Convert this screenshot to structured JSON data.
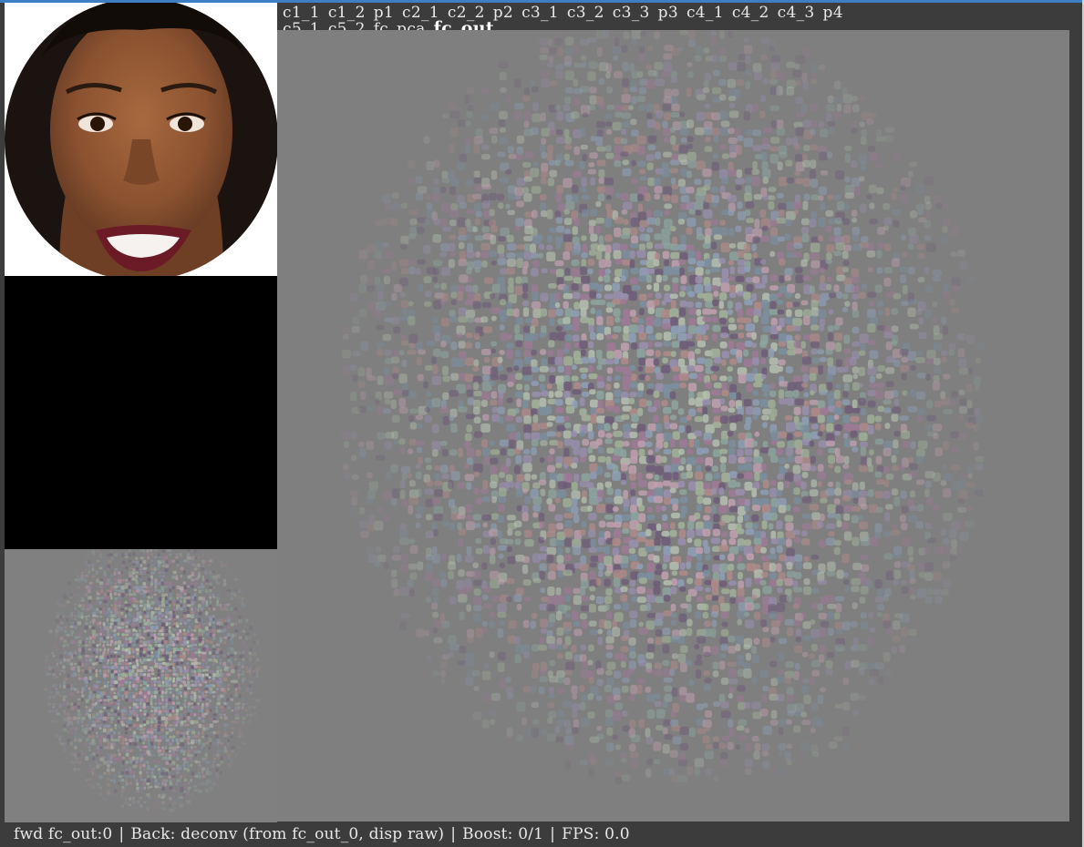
{
  "layers": {
    "row1": [
      "c1_1",
      "c1_2",
      "p1",
      "c2_1",
      "c2_2",
      "p2",
      "c3_1",
      "c3_2",
      "c3_3",
      "p3",
      "c4_1",
      "c4_2",
      "c4_3",
      "p4"
    ],
    "row2": [
      "c5_1",
      "c5_2",
      "fc",
      "pca",
      "fc_out"
    ],
    "selected": "fc_out"
  },
  "status": {
    "fwd": "fwd fc_out:0",
    "back": "Back: deconv (from fc_out_0, disp raw)",
    "boost": "Boost: 0/1",
    "fps": "FPS: 0.0"
  },
  "colors": {
    "background": "#3c3c3c",
    "deconv_gray": "#808080",
    "text": "#e8e8e8",
    "top_accent": "#3d7fc2"
  },
  "panels": {
    "input_image": "face-photo",
    "empty_panel": "black",
    "small_visualization": "deconv-noise-face",
    "main_visualization": "deconv-noise-face"
  }
}
